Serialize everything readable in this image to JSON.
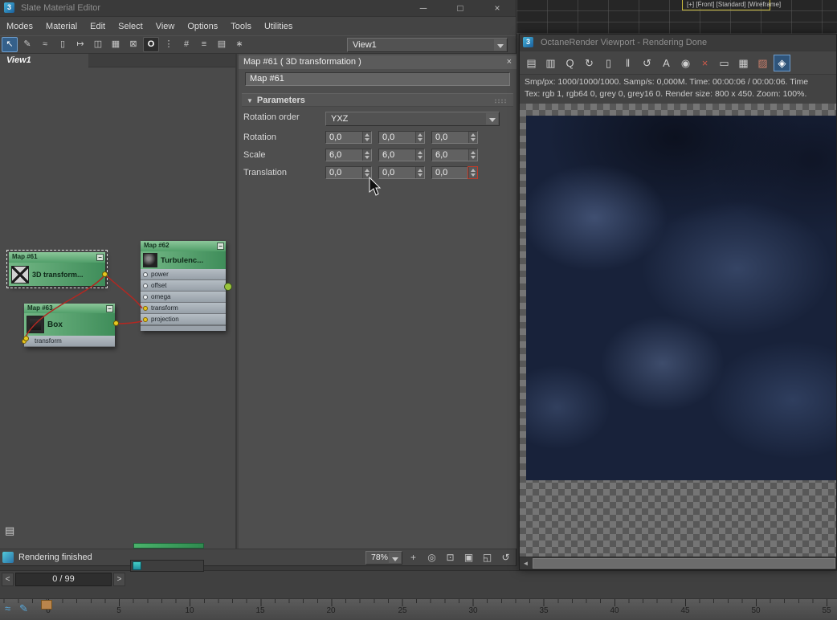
{
  "slate": {
    "title": "Slate Material Editor",
    "titlebar_buttons": {
      "minimize": "─",
      "maximize": "□",
      "close": "×"
    },
    "menus": [
      "Modes",
      "Material",
      "Edit",
      "Select",
      "View",
      "Options",
      "Tools",
      "Utilities"
    ],
    "toolbar_icons": [
      {
        "name": "select-arrow",
        "glyph": "↖"
      },
      {
        "name": "pick-material",
        "glyph": "✎"
      },
      {
        "name": "freehand-select",
        "glyph": "≈"
      },
      {
        "name": "delete-selected",
        "glyph": "▯"
      },
      {
        "name": "move-children",
        "glyph": "↦"
      },
      {
        "name": "hide-unused-slots",
        "glyph": "◫"
      },
      {
        "name": "show-grid",
        "glyph": "▦"
      },
      {
        "name": "show-background",
        "glyph": "⊠"
      },
      {
        "name": "octane-tool",
        "glyph": "O"
      },
      {
        "name": "layout-all",
        "glyph": "⋮"
      },
      {
        "name": "layout-children",
        "glyph": "#"
      },
      {
        "name": "select-options",
        "glyph": "≡"
      },
      {
        "name": "material-preview",
        "glyph": "▤"
      },
      {
        "name": "render-map",
        "glyph": "∗"
      }
    ],
    "view_selector": "View1",
    "view_tab": "View1",
    "params": {
      "panel_title": "Map #61  ( 3D transformation )",
      "close_glyph": "×",
      "name_field": "Map #61",
      "rollout_arrow": "▼",
      "rollout_title": "Parameters",
      "rotation_order_label": "Rotation order",
      "rotation_order_value": "YXZ",
      "rows": [
        {
          "label": "Rotation",
          "values": [
            "0,0",
            "0,0",
            "0,0"
          ]
        },
        {
          "label": "Scale",
          "values": [
            "6,0",
            "6,0",
            "6,0"
          ]
        },
        {
          "label": "Translation",
          "values": [
            "0,0",
            "0,0",
            "0,0"
          ]
        }
      ]
    },
    "status": {
      "text": "Rendering finished",
      "zoom": "78%"
    },
    "status_icons": [
      {
        "name": "pan-hand",
        "glyph": "+"
      },
      {
        "name": "zoom",
        "glyph": "◎"
      },
      {
        "name": "zoom-region",
        "glyph": "⊡"
      },
      {
        "name": "zoom-extents",
        "glyph": "▣"
      },
      {
        "name": "zoom-extents-selected",
        "glyph": "◱"
      },
      {
        "name": "pan-to-selected",
        "glyph": "↺"
      }
    ],
    "corner_icon_glyph": "▤"
  },
  "nodes": {
    "map61": {
      "title": "Map #61",
      "subtitle": "3D transform...",
      "collapse": "−"
    },
    "map62": {
      "title": "Map #62",
      "subtitle": "Turbulenc...",
      "collapse": "−",
      "slots": [
        "power",
        "offset",
        "omega",
        "transform",
        "projection"
      ]
    },
    "map63": {
      "title": "Map #63",
      "subtitle": "Box",
      "collapse": "−",
      "slot": "transform"
    }
  },
  "octane": {
    "title": "OctaneRender Viewport - Rendering Done",
    "toolbar_icons": [
      {
        "name": "save-render",
        "glyph": "▤"
      },
      {
        "name": "copy-render",
        "glyph": "▥"
      },
      {
        "name": "search",
        "glyph": "Q"
      },
      {
        "name": "refresh",
        "glyph": "↻"
      },
      {
        "name": "lock-resolution",
        "glyph": "▯"
      },
      {
        "name": "pause-rendering",
        "glyph": "‖"
      },
      {
        "name": "restart-rendering",
        "glyph": "↺"
      },
      {
        "name": "focus-picker",
        "glyph": "A"
      },
      {
        "name": "camera-target",
        "glyph": "◉"
      },
      {
        "name": "stop-rendering",
        "glyph": "×"
      },
      {
        "name": "monitor-view",
        "glyph": "▭"
      },
      {
        "name": "film-region",
        "glyph": "▦"
      },
      {
        "name": "render-passes",
        "glyph": "▨"
      },
      {
        "name": "material-picker",
        "glyph": "◈"
      }
    ],
    "stats_line1": "Smp/px: 1000/1000/1000.  Samp/s: 0,000M.  Time: 00:00:06 / 00:00:06.  Time",
    "stats_line2": "Tex: rgb 1, rgb64 0, grey 0, grey16 0.  Render size: 800 x 450.  Zoom: 100%.",
    "scrollbar_left": "◄"
  },
  "background": {
    "viewport_label": "[+] [Front] [Standard] [Wireframe]",
    "trackbar_icons": [
      {
        "name": "mini-curve-editor",
        "glyph": "≈"
      },
      {
        "name": "trackbar-key-mode",
        "glyph": "✎"
      }
    ]
  },
  "timeline": {
    "prev": "<",
    "frame_field": "0 / 99",
    "next": ">",
    "ruler_labels": [
      "0",
      "5",
      "10",
      "15",
      "20",
      "25",
      "30",
      "35",
      "40",
      "45",
      "50",
      "55"
    ]
  }
}
